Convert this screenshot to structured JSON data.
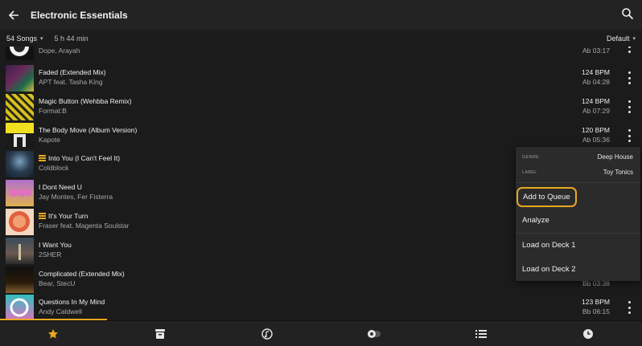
{
  "header": {
    "title": "Electronic Essentials",
    "back_icon": "arrow-left-icon",
    "search_icon": "search-icon"
  },
  "subbar": {
    "count": "54 Songs",
    "duration": "5 h 44 min",
    "sort": "Default"
  },
  "tracks": [
    {
      "title": "",
      "artist": "Dope, Arayah",
      "bpm": "",
      "key": "Ab 03:17",
      "queued": false
    },
    {
      "title": "Faded (Extended Mix)",
      "artist": "APT feat. Tasha King",
      "bpm": "124 BPM",
      "key": "Ab 04:28",
      "queued": false
    },
    {
      "title": "Magic Button (Wehbba Remix)",
      "artist": "Format:B",
      "bpm": "124 BPM",
      "key": "Ab 07:29",
      "queued": false
    },
    {
      "title": "The Body Move (Album Version)",
      "artist": "Kapote",
      "bpm": "120 BPM",
      "key": "Ab 05:36",
      "queued": false
    },
    {
      "title": "Into You (I Can't Feel It)",
      "artist": "Coldblock",
      "bpm": "",
      "key": "",
      "queued": true
    },
    {
      "title": "I Dont Need U",
      "artist": "Jay Montes, Fer Fisterra",
      "bpm": "",
      "key": "",
      "queued": false
    },
    {
      "title": "It's Your Turn",
      "artist": "Fraser feat. Magenta Soulstar",
      "bpm": "",
      "key": "",
      "queued": true
    },
    {
      "title": "I Want You",
      "artist": "2SHER",
      "bpm": "",
      "key": "",
      "queued": false
    },
    {
      "title": "Complicated (Extended Mix)",
      "artist": "Bear, StecU",
      "bpm": "",
      "key": "Bb 03:38",
      "queued": false
    },
    {
      "title": "Questions In My Mind",
      "artist": "Andy Caldwell",
      "bpm": "123 BPM",
      "key": "Bb 06:15",
      "queued": false
    }
  ],
  "context_menu": {
    "genre_label": "GENRE",
    "genre_value": "Deep House",
    "label_label": "LABEL",
    "label_value": "Toy Tonics",
    "add_to_queue": "Add to Queue",
    "analyze": "Analyze",
    "load_deck_1": "Load on Deck 1",
    "load_deck_2": "Load on Deck 2"
  },
  "bottom_nav": [
    "star-icon",
    "archive-icon",
    "music-note-icon",
    "toggle-icon",
    "list-icon",
    "history-icon"
  ],
  "colors": {
    "accent": "#e8a81f",
    "background": "#1b1b1b",
    "surface": "#2b2b2b"
  }
}
